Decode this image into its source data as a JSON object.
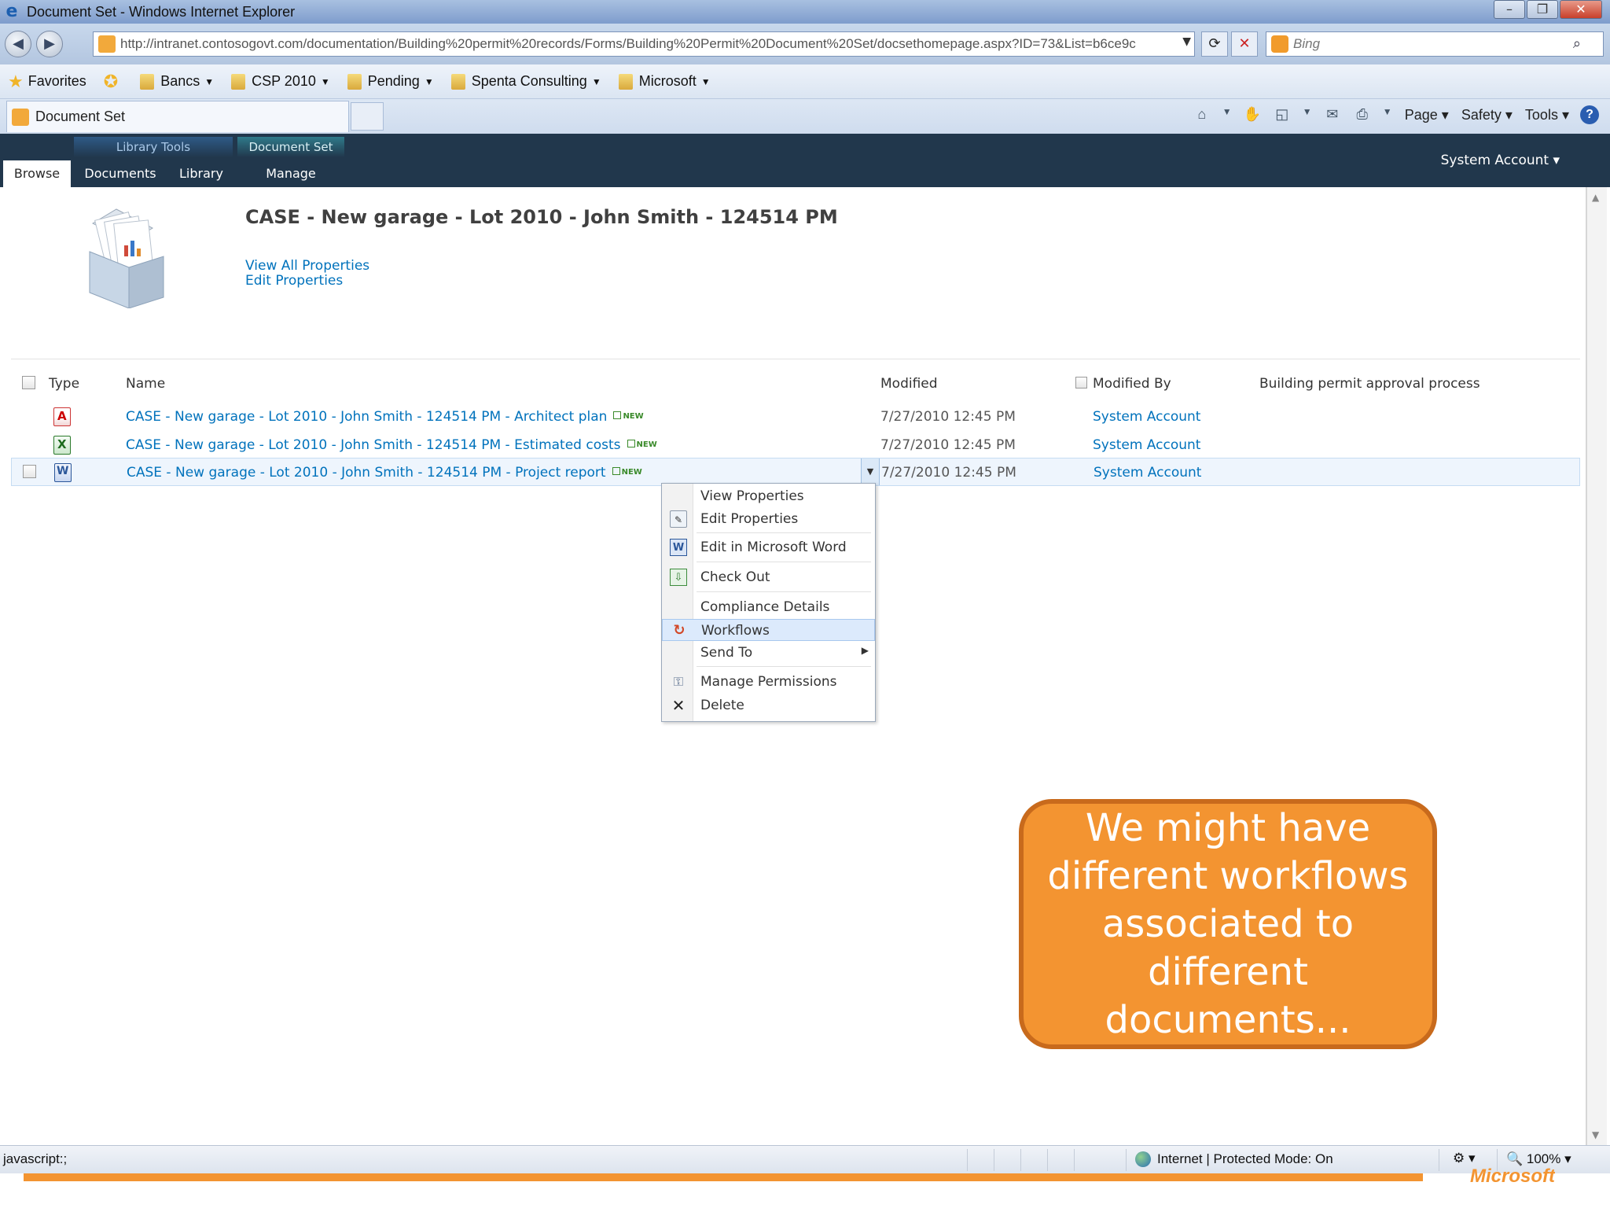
{
  "window": {
    "title": "Document Set - Windows Internet Explorer"
  },
  "address": {
    "url": "http://intranet.contosogovt.com/documentation/Building%20permit%20records/Forms/Building%20Permit%20Document%20Set/docsethomepage.aspx?ID=73&List=b6ce9c",
    "search_placeholder": "Bing"
  },
  "favorites": {
    "label": "Favorites",
    "items": [
      "Bancs",
      "CSP 2010",
      "Pending",
      "Spenta Consulting",
      "Microsoft"
    ]
  },
  "tab": {
    "title": "Document Set"
  },
  "command_bar": {
    "page": "Page",
    "safety": "Safety",
    "tools": "Tools"
  },
  "ribbon": {
    "groups": {
      "library_tools": "Library Tools",
      "document_set": "Document Set"
    },
    "tabs": {
      "browse": "Browse",
      "documents": "Documents",
      "library": "Library",
      "manage": "Manage"
    },
    "account": "System Account ▾"
  },
  "docset": {
    "title": "CASE - New garage - Lot 2010 - John Smith - 124514 PM",
    "view_all_properties": "View All Properties",
    "edit_properties": "Edit Properties"
  },
  "list": {
    "headers": {
      "type": "Type",
      "name": "Name",
      "modified": "Modified",
      "modified_by": "Modified By",
      "workflow": "Building permit approval process"
    },
    "new_badge": "NEW",
    "rows": [
      {
        "type": "pdf",
        "name": "CASE - New garage - Lot 2010 - John Smith - 124514 PM - Architect plan",
        "modified": "7/27/2010 12:45 PM",
        "modified_by": "System Account"
      },
      {
        "type": "xlsx",
        "name": "CASE - New garage - Lot 2010 - John Smith - 124514 PM - Estimated costs",
        "modified": "7/27/2010 12:45 PM",
        "modified_by": "System Account"
      },
      {
        "type": "docx",
        "name": "CASE - New garage - Lot 2010 - John Smith - 124514 PM - Project report",
        "modified": "7/27/2010 12:45 PM",
        "modified_by": "System Account"
      }
    ]
  },
  "context_menu": {
    "items": [
      "View Properties",
      "Edit Properties",
      "Edit in Microsoft Word",
      "Check Out",
      "Compliance Details",
      "Workflows",
      "Send To",
      "Manage Permissions",
      "Delete"
    ],
    "highlighted": "Workflows"
  },
  "callout": {
    "text": "We might have different workflows associated to different documents..."
  },
  "status": {
    "left": "javascript:;",
    "zone": "Internet | Protected Mode: On",
    "zoom": "100%"
  },
  "colors": {
    "ribbon_bg": "#21374c",
    "link": "#0072bc",
    "callout_fill": "#f39431",
    "callout_border": "#c86a1c"
  }
}
